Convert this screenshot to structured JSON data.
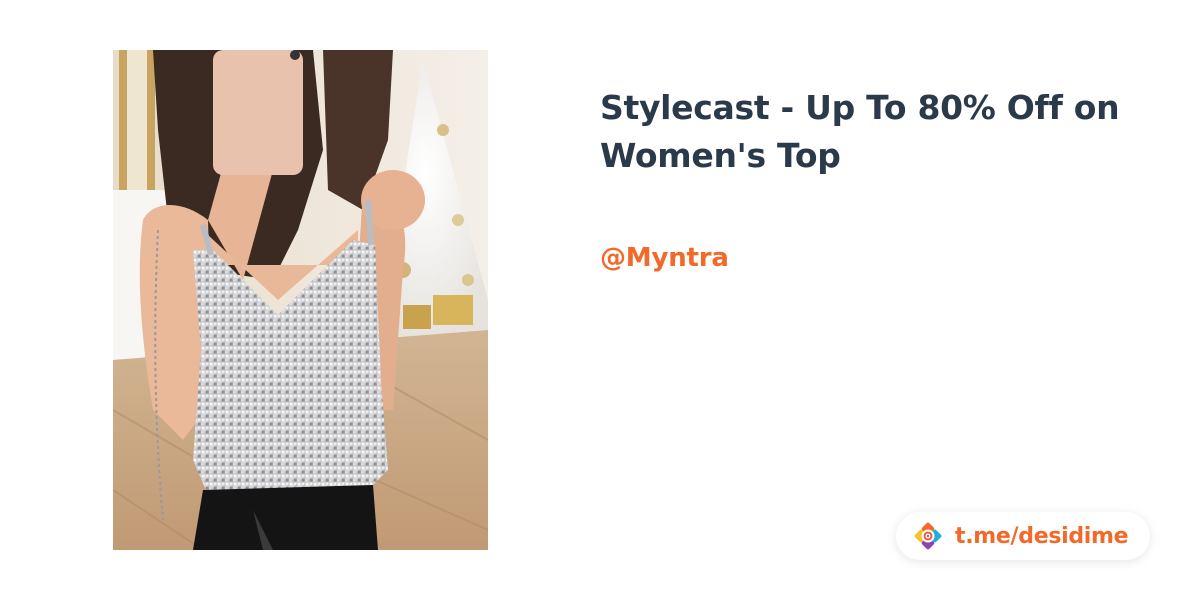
{
  "deal": {
    "title": "Stylecast - Up To 80% Off on Women's Top",
    "store": "@Myntra"
  },
  "channel_badge": {
    "link_text": "t.me/desidime",
    "logo_icon": "desidime-logo-icon"
  },
  "product_image": {
    "icon": "product-photo"
  },
  "colors": {
    "title": "#2b3a4a",
    "accent": "#f26a2a",
    "background": "#ffffff"
  }
}
